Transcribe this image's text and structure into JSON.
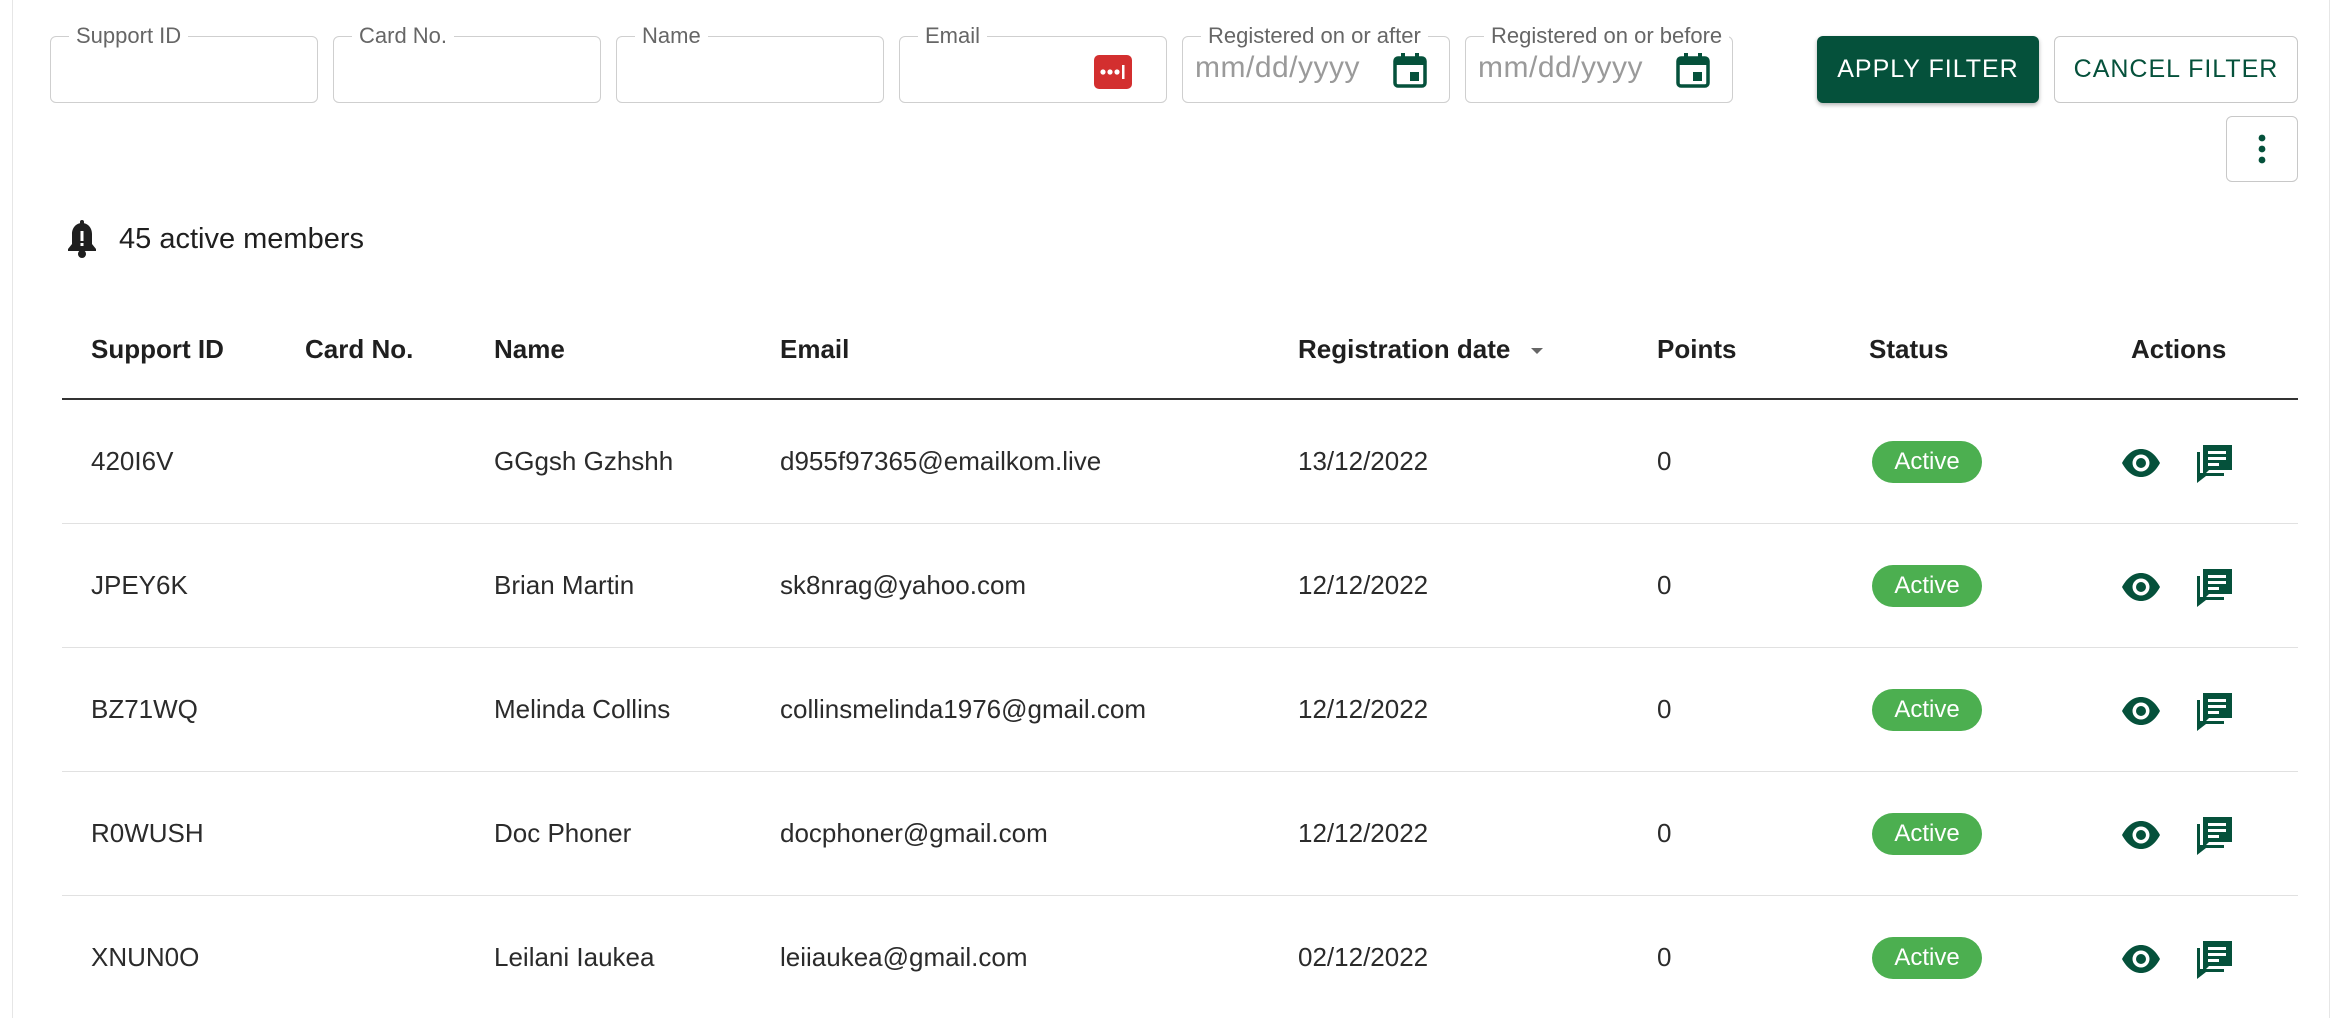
{
  "filters": {
    "support_id_label": "Support ID",
    "card_no_label": "Card No.",
    "name_label": "Name",
    "email_label": "Email",
    "registered_after_label": "Registered on or after",
    "registered_before_label": "Registered on or before",
    "date_placeholder": "mm/dd/yyyy"
  },
  "buttons": {
    "apply": "APPLY FILTER",
    "cancel": "CANCEL FILTER"
  },
  "summary": {
    "text": "45 active members"
  },
  "table": {
    "headers": {
      "support_id": "Support ID",
      "card_no": "Card No.",
      "name": "Name",
      "email": "Email",
      "registration_date": "Registration date",
      "points": "Points",
      "status": "Status",
      "actions": "Actions"
    },
    "rows": [
      {
        "support_id": "420I6V",
        "card_no": "",
        "name": "GGgsh Gzhshh",
        "email": "d955f97365@emailkom.live",
        "date": "13/12/2022",
        "points": "0",
        "status": "Active"
      },
      {
        "support_id": "JPEY6K",
        "card_no": "",
        "name": "Brian Martin",
        "email": "sk8nrag@yahoo.com",
        "date": "12/12/2022",
        "points": "0",
        "status": "Active"
      },
      {
        "support_id": "BZ71WQ",
        "card_no": "",
        "name": "Melinda Collins",
        "email": "collinsmelinda1976@gmail.com",
        "date": "12/12/2022",
        "points": "0",
        "status": "Active"
      },
      {
        "support_id": "R0WUSH",
        "card_no": "",
        "name": "Doc Phoner",
        "email": "docphoner@gmail.com",
        "date": "12/12/2022",
        "points": "0",
        "status": "Active"
      },
      {
        "support_id": "XNUN0O",
        "card_no": "",
        "name": "Leilani Iaukea",
        "email": "leiiaukea@gmail.com",
        "date": "02/12/2022",
        "points": "0",
        "status": "Active"
      }
    ]
  },
  "colors": {
    "primary": "#05513b",
    "status_active": "#4caf50",
    "password_manager": "#d32f2f"
  },
  "icons": {
    "password_manager": "password-dots-icon",
    "date": "calendar-icon",
    "more": "more-vertical-icon",
    "summary": "bell-icon",
    "sort": "sort-descending-icon",
    "view": "eye-icon",
    "message": "chat-icon"
  }
}
